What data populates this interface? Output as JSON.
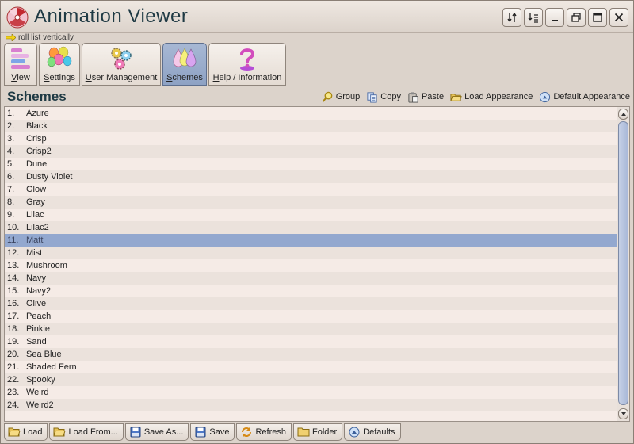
{
  "window": {
    "title": "Animation Viewer"
  },
  "hint": {
    "text": "roll list vertically"
  },
  "toolbar": {
    "items": [
      {
        "label": "View",
        "icon": "view-list-icon"
      },
      {
        "label": "Settings",
        "icon": "balloons-icon"
      },
      {
        "label": "User Management",
        "icon": "gears-icon"
      },
      {
        "label": "Schemes",
        "icon": "color-drops-icon",
        "active": true
      },
      {
        "label": "Help / Information",
        "icon": "question-icon"
      }
    ]
  },
  "section": {
    "title": "Schemes",
    "actions": [
      {
        "label": "Group",
        "icon": "magnifier-icon"
      },
      {
        "label": "Copy",
        "icon": "copy-icon"
      },
      {
        "label": "Paste",
        "icon": "paste-icon"
      },
      {
        "label": "Load Appearance",
        "icon": "folder-open-icon"
      },
      {
        "label": "Default Appearance",
        "icon": "default-circle-icon"
      }
    ]
  },
  "schemes": [
    {
      "num": "1.",
      "name": "Azure"
    },
    {
      "num": "2.",
      "name": "Black"
    },
    {
      "num": "3.",
      "name": "Crisp"
    },
    {
      "num": "4.",
      "name": "Crisp2"
    },
    {
      "num": "5.",
      "name": "Dune"
    },
    {
      "num": "6.",
      "name": "Dusty Violet"
    },
    {
      "num": "7.",
      "name": "Glow"
    },
    {
      "num": "8.",
      "name": "Gray"
    },
    {
      "num": "9.",
      "name": "Lilac"
    },
    {
      "num": "10.",
      "name": "Lilac2"
    },
    {
      "num": "11.",
      "name": "Matt",
      "selected": true
    },
    {
      "num": "12.",
      "name": "Mist"
    },
    {
      "num": "13.",
      "name": "Mushroom"
    },
    {
      "num": "14.",
      "name": "Navy"
    },
    {
      "num": "15.",
      "name": "Navy2"
    },
    {
      "num": "16.",
      "name": "Olive"
    },
    {
      "num": "17.",
      "name": "Peach"
    },
    {
      "num": "18.",
      "name": "Pinkie"
    },
    {
      "num": "19.",
      "name": "Sand"
    },
    {
      "num": "20.",
      "name": "Sea Blue"
    },
    {
      "num": "21.",
      "name": "Shaded Fern"
    },
    {
      "num": "22.",
      "name": "Spooky"
    },
    {
      "num": "23.",
      "name": "Weird"
    },
    {
      "num": "24.",
      "name": "Weird2"
    }
  ],
  "bottombar": {
    "buttons": [
      {
        "label": "Load",
        "icon": "folder-open-icon"
      },
      {
        "label": "Load From...",
        "icon": "folder-open-icon"
      },
      {
        "label": "Save As...",
        "icon": "floppy-icon"
      },
      {
        "label": "Save",
        "icon": "floppy-icon"
      },
      {
        "label": "Refresh",
        "icon": "refresh-icon"
      },
      {
        "label": "Folder",
        "icon": "folder-icon"
      },
      {
        "label": "Defaults",
        "icon": "default-circle-icon"
      }
    ]
  },
  "colors": {
    "selected_row": "#93a8cf",
    "active_tab": "#93a8cf",
    "title_text": "#1f3a44"
  }
}
